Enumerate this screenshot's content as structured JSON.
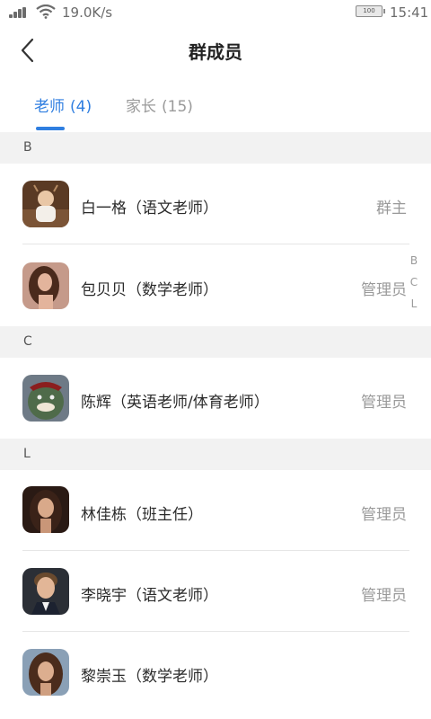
{
  "status_bar": {
    "network_speed": "19.0K/s",
    "battery": "100",
    "time": "15:41"
  },
  "nav": {
    "title": "群成员",
    "back_icon": "chevron-left-icon"
  },
  "tabs": [
    {
      "label": "老师",
      "count": "(4)",
      "active": true
    },
    {
      "label": "家长",
      "count": "(15)",
      "active": false
    }
  ],
  "index_letters": [
    "B",
    "C",
    "L"
  ],
  "sections": [
    {
      "letter": "B",
      "members": [
        {
          "name": "白一格（语文老师）",
          "role": "群主"
        },
        {
          "name": "包贝贝（数学老师）",
          "role": "管理员"
        }
      ]
    },
    {
      "letter": "C",
      "members": [
        {
          "name": "陈辉（英语老师/体育老师）",
          "role": "管理员"
        }
      ]
    },
    {
      "letter": "L",
      "members": [
        {
          "name": "林佳栋（班主任）",
          "role": "管理员"
        },
        {
          "name": "李晓宇（语文老师）",
          "role": "管理员"
        },
        {
          "name": "黎崇玉（数学老师）",
          "role": ""
        }
      ]
    }
  ],
  "colors": {
    "accent": "#2f7ee0",
    "section_bg": "#f2f2f2",
    "muted_text": "#9a9a9a"
  }
}
